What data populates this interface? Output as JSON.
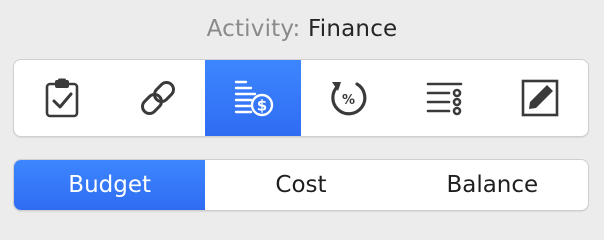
{
  "header": {
    "label": "Activity:",
    "value": "Finance"
  },
  "toolbar": {
    "icons": [
      {
        "name": "clipboard-check-icon",
        "selected": false
      },
      {
        "name": "link-icon",
        "selected": false
      },
      {
        "name": "budget-dollar-icon",
        "selected": true
      },
      {
        "name": "percent-refresh-icon",
        "selected": false
      },
      {
        "name": "list-icon",
        "selected": false
      },
      {
        "name": "edit-icon",
        "selected": false
      }
    ]
  },
  "segments": {
    "items": [
      "Budget",
      "Cost",
      "Balance"
    ],
    "selected": "Budget"
  },
  "colors": {
    "accent": "#3479f6",
    "icon": "#3a3a3a"
  }
}
